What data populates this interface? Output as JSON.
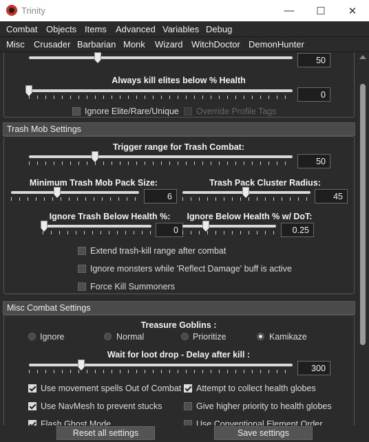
{
  "window": {
    "title": "Trinity",
    "minimize": "—",
    "maximize": "☐",
    "close": "✕"
  },
  "menu": [
    "Combat",
    "Objects",
    "Items",
    "Advanced",
    "Variables",
    "Debug"
  ],
  "class_tabs": [
    "Misc",
    "Crusader",
    "Barbarian",
    "Monk",
    "Wizard",
    "WitchDoctor",
    "DemonHunter"
  ],
  "top_section": {
    "slider_a": {
      "value": "50",
      "level": 0.25
    },
    "elite_kill": {
      "label": "Always kill elites below % Health",
      "value": "0",
      "level": 0.0
    },
    "ignore_elite": {
      "label": "Ignore Elite/Rare/Unique",
      "checked": false
    },
    "override_tags": {
      "label": "Override Profile Tags",
      "checked": false,
      "disabled": true
    }
  },
  "trash": {
    "header": "Trash Mob Settings",
    "trigger_range": {
      "label": "Trigger range for Trash Combat:",
      "value": "50",
      "level": 0.25
    },
    "pack_size": {
      "label": "Minimum Trash Mob Pack Size:",
      "value": "6",
      "level": 0.35
    },
    "cluster_radius": {
      "label": "Trash Pack Cluster Radius:",
      "value": "45",
      "level": 0.5
    },
    "ignore_health": {
      "label": "Ignore Trash Below Health %:",
      "value": "0",
      "level": 0.0
    },
    "ignore_dot": {
      "label": "Ignore Below Health % w/ DoT:",
      "value": "0.25",
      "level": 0.25
    },
    "options": [
      {
        "label": "Extend trash-kill range after combat",
        "checked": false
      },
      {
        "label": "Ignore monsters while 'Reflect Damage' buff is active",
        "checked": false
      },
      {
        "label": "Force Kill Summoners",
        "checked": false
      }
    ]
  },
  "misc": {
    "header": "Misc Combat Settings",
    "goblins_label": "Treasure Goblins :",
    "goblin_options": [
      "Ignore",
      "Normal",
      "Prioritize",
      "Kamikaze"
    ],
    "goblin_selected": "Kamikaze",
    "loot_delay": {
      "label": "Wait for loot drop - Delay after kill :",
      "value": "300",
      "level": 0.2
    },
    "left_options": [
      {
        "label": "Use movement spells Out of Combat",
        "checked": true
      },
      {
        "label": "Use NavMesh to prevent stucks",
        "checked": true
      },
      {
        "label": "Flash Ghost Mode",
        "checked": true
      }
    ],
    "right_options": [
      {
        "label": "Attempt to collect health globes",
        "checked": true
      },
      {
        "label": "Give higher priority to health globes",
        "checked": false
      },
      {
        "label": "Use Conventional Element Order",
        "checked": false
      }
    ]
  },
  "buttons": {
    "reset": "Reset all settings",
    "save": "Save settings"
  }
}
